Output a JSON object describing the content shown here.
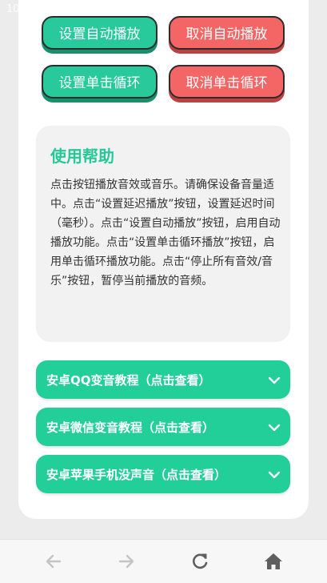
{
  "status": {
    "time": "10:04",
    "download_icon": "download-arrow-icon"
  },
  "buttons": [
    {
      "label": "设置自动播放",
      "color": "#28c99a"
    },
    {
      "label": "取消自动播放",
      "color": "#f46565"
    },
    {
      "label": "设置单击循环",
      "color": "#28c99a"
    },
    {
      "label": "取消单击循环",
      "color": "#f46565"
    }
  ],
  "help": {
    "title": "使用帮助",
    "body": "点击按钮播放音效或音乐。请确保设备音量适中。点击“设置延迟播放”按钮，设置延迟时间（毫秒）。点击“设置自动播放”按钮，启用自动播放功能。点击“设置单击循环播放”按钮，启用单击循环播放功能。点击“停止所有音效/音乐”按钮，暂停当前播放的音频。"
  },
  "accordions": [
    {
      "label": "安卓QQ变音教程（点击查看）"
    },
    {
      "label": "安卓微信变音教程（点击查看）"
    },
    {
      "label": "安卓苹果手机没声音（点击查看）"
    }
  ],
  "nav": {
    "icons": [
      "back-arrow-icon",
      "forward-arrow-icon",
      "refresh-icon",
      "home-icon"
    ]
  },
  "colors": {
    "accent": "#23cf98",
    "danger": "#f46565",
    "title": "#26c896"
  }
}
